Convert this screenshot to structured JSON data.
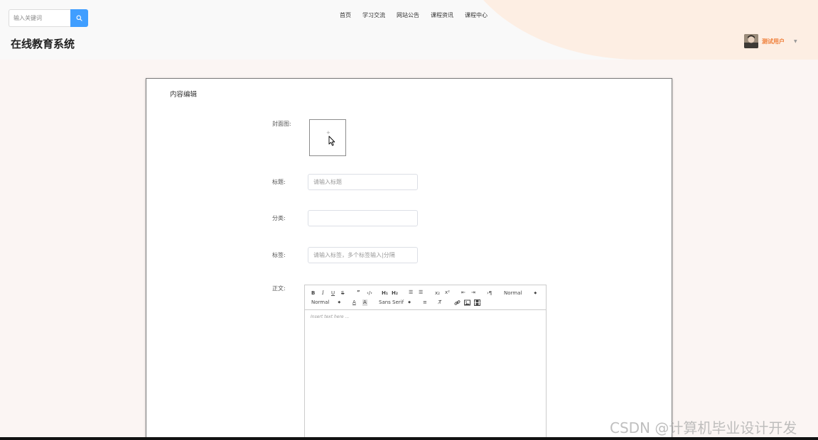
{
  "search": {
    "placeholder": "输入关键词"
  },
  "site": {
    "title": "在线教育系统"
  },
  "nav": {
    "items": [
      "首页",
      "学习交流",
      "网站公告",
      "课程资讯",
      "课程中心"
    ]
  },
  "user": {
    "name": "测试用户"
  },
  "form": {
    "heading": "内容编辑",
    "cover_label": "封面图:",
    "title_label": "标题:",
    "title_placeholder": "请输入标题",
    "category_label": "分类:",
    "category_value": "",
    "tags_label": "标签:",
    "tags_placeholder": "请输入标签，多个标签输入|分隔",
    "body_label": "正文:"
  },
  "editor": {
    "header_select": "Normal",
    "size_select": "Normal",
    "font_select": "Sans Serif",
    "placeholder": "Insert text here ..."
  },
  "watermark": "CSDN @计算机毕业设计开发",
  "colors": {
    "accent": "#409eff",
    "user_name": "#ef7d37",
    "header_deco": "#fdeee3"
  }
}
